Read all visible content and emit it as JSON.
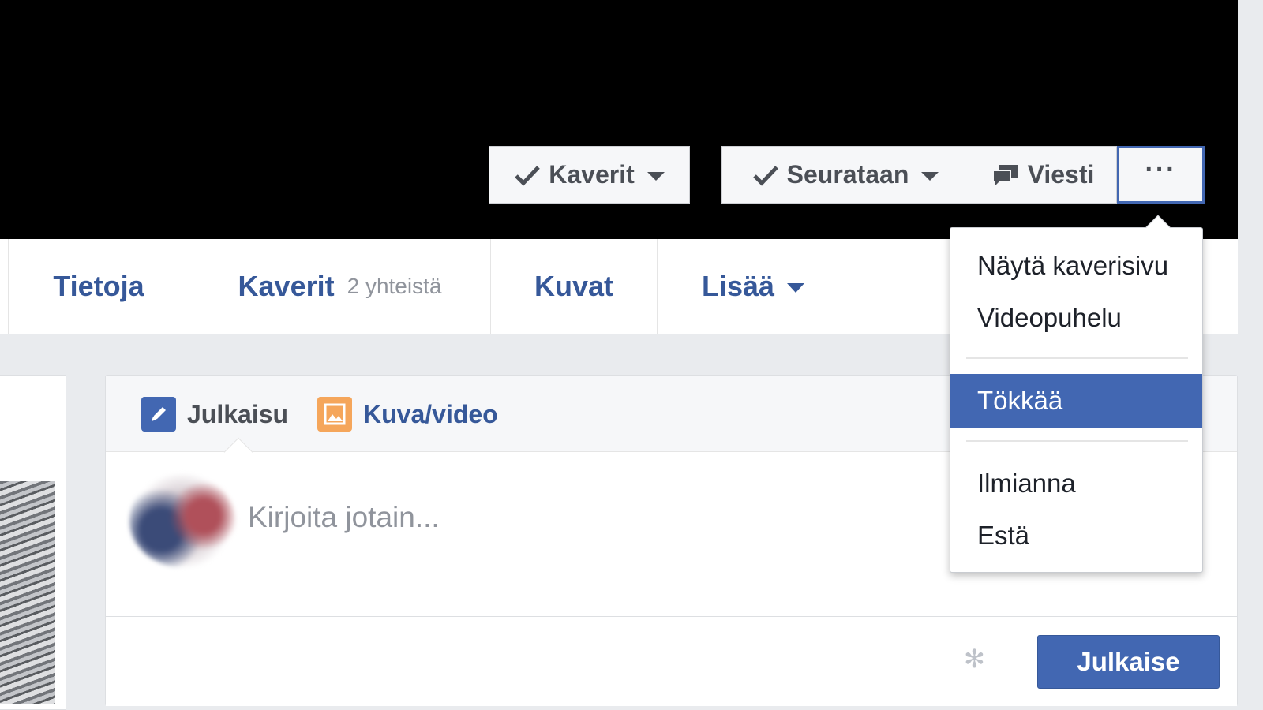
{
  "cover": {
    "friends_label": "Kaverit",
    "following_label": "Seurataan",
    "message_label": "Viesti",
    "more_label": "···"
  },
  "nav": {
    "about": "Tietoja",
    "friends": "Kaverit",
    "mutual": "2 yhteistä",
    "photos": "Kuvat",
    "more": "Lisää"
  },
  "composer": {
    "tab_post": "Julkaisu",
    "tab_photo_video": "Kuva/video",
    "placeholder": "Kirjoita jotain...",
    "publish_label": "Julkaise"
  },
  "menu": {
    "items": [
      "Näytä kaverisivu",
      "Videopuhelu",
      "Tökkää",
      "Ilmianna",
      "Estä"
    ],
    "highlighted_index": 2
  },
  "colors": {
    "brand_blue": "#4267b2",
    "link_blue": "#365899",
    "photo_orange": "#f5a65b"
  },
  "icons": {
    "check": "check-icon",
    "caret": "caret-down-icon",
    "message": "message-icon",
    "more": "more-dots-icon",
    "pencil": "pencil-icon",
    "photo": "photo-icon",
    "gear": "gear-icon"
  }
}
